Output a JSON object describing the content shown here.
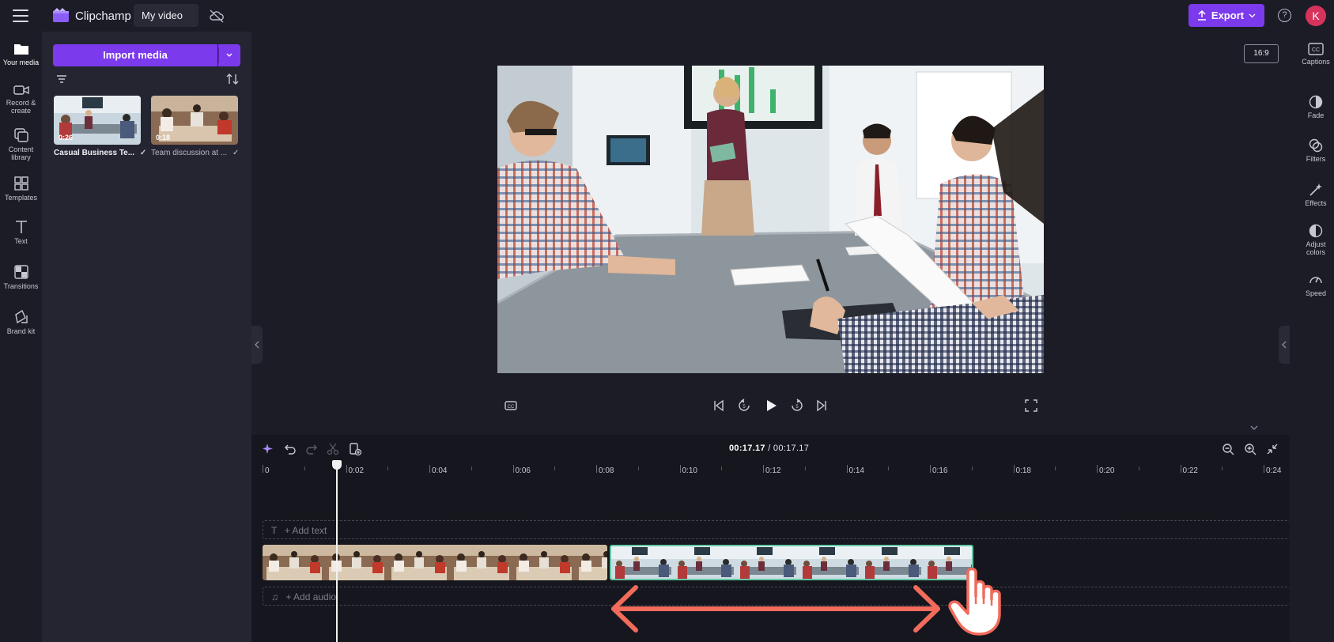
{
  "app": {
    "brand": "Clipchamp",
    "project_title": "My video",
    "export_label": "Export",
    "avatar_initial": "K",
    "help_glyph": "?"
  },
  "left_rail": [
    {
      "label": "Your media",
      "icon": "folder-icon"
    },
    {
      "label": "Record &\ncreate",
      "icon": "video-camera-icon"
    },
    {
      "label": "Content\nlibrary",
      "icon": "library-icon"
    },
    {
      "label": "Templates",
      "icon": "templates-icon"
    },
    {
      "label": "Text",
      "icon": "text-icon"
    },
    {
      "label": "Transitions",
      "icon": "transitions-icon"
    },
    {
      "label": "Brand kit",
      "icon": "brand-kit-icon"
    }
  ],
  "media_panel": {
    "import_label": "Import media",
    "items": [
      {
        "title": "Casual Business Te...",
        "duration": "0:26"
      },
      {
        "title": "Team discussion at ...",
        "duration": "0:18"
      }
    ]
  },
  "preview": {
    "aspect_ratio": "16:9"
  },
  "right_rail": [
    {
      "label": "Captions",
      "icon": "captions-icon"
    },
    {
      "label": "Fade",
      "icon": "fade-icon"
    },
    {
      "label": "Filters",
      "icon": "filters-icon"
    },
    {
      "label": "Effects",
      "icon": "effects-icon"
    },
    {
      "label": "Adjust\ncolors",
      "icon": "adjust-colors-icon"
    },
    {
      "label": "Speed",
      "icon": "speed-icon"
    }
  ],
  "timeline": {
    "current_time": "00:17.17",
    "total_time": "/ 00:17.17",
    "ruler_labels": [
      "0",
      "0:02",
      "0:04",
      "0:06",
      "0:08",
      "0:10",
      "0:12",
      "0:14",
      "0:16",
      "0:18",
      "0:20",
      "0:22",
      "0:24"
    ],
    "add_text_label": "+ Add text",
    "add_audio_label": "+ Add audio"
  },
  "colors": {
    "accent": "#7c3aed",
    "selected_clip_border": "#63c7a5",
    "drag_arrow": "#f26b5b",
    "avatar": "#d6335c"
  }
}
